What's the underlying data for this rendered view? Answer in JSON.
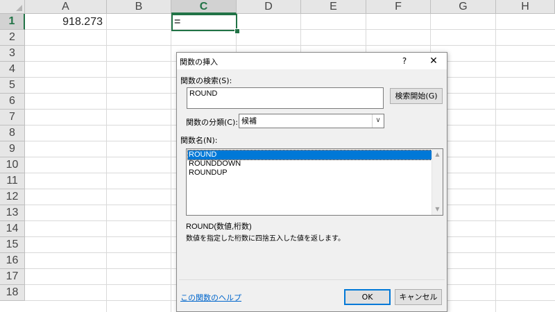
{
  "sheet": {
    "columns": [
      "A",
      "B",
      "C",
      "D",
      "E",
      "F",
      "G",
      "H"
    ],
    "rows": [
      "1",
      "2",
      "3",
      "4",
      "5",
      "6",
      "7",
      "8",
      "9",
      "10",
      "11",
      "12",
      "13",
      "14",
      "15",
      "16",
      "17",
      "18"
    ],
    "selected_column": "C",
    "selected_row": "1",
    "cells": {
      "A1": "918.273",
      "C1": "="
    }
  },
  "dialog": {
    "title": "関数の挿入",
    "help_glyph": "?",
    "close_glyph": "✕",
    "search_label": "関数の検索(S):",
    "search_value": "ROUND",
    "search_button": "検索開始(G)",
    "category_label": "関数の分類(C):",
    "category_value": "候補",
    "function_label": "関数名(N):",
    "functions": [
      "ROUND",
      "ROUNDDOWN",
      "ROUNDUP"
    ],
    "selected_function": "ROUND",
    "syntax": "ROUND(数値,桁数)",
    "description": "数値を指定した桁数に四捨五入した値を返します。",
    "help_link": "この関数のヘルプ",
    "ok_button": "OK",
    "cancel_button": "キャンセル"
  },
  "colors": {
    "excel_green": "#217346",
    "selection_blue": "#0078d7",
    "link_blue": "#0066cc"
  }
}
